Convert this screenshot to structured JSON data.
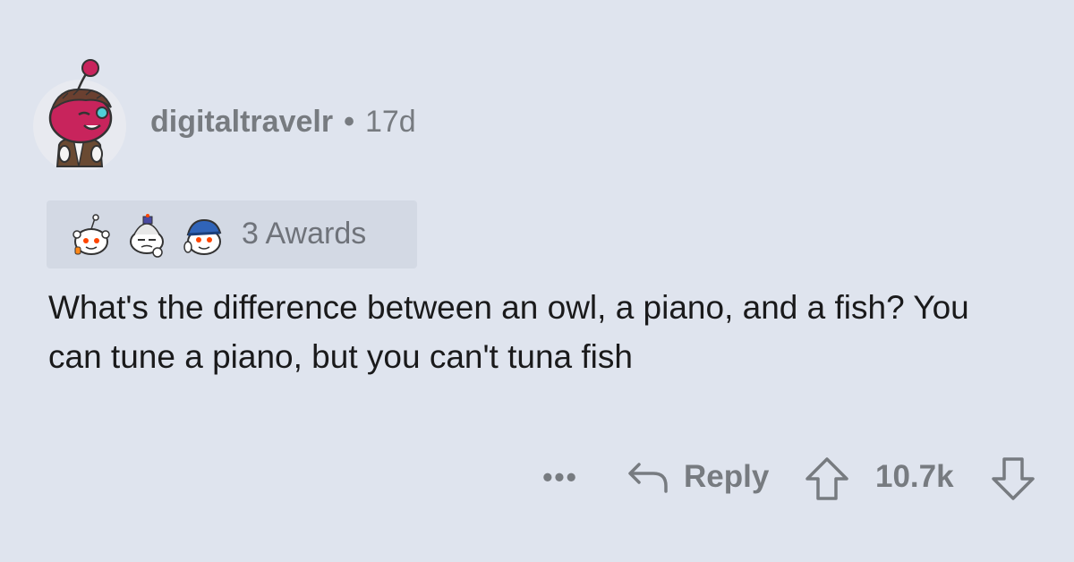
{
  "comment": {
    "author": "digitaltravelr",
    "separator": "•",
    "age": "17d",
    "avatar_icon": "snoo-avatar-icon",
    "awards": {
      "label": "3 Awards",
      "icons": [
        "wholesome-award-icon",
        "take-my-energy-award-icon",
        "helpful-award-icon"
      ]
    },
    "body": "What's the difference between an owl, a piano, and a fish? You can tune a piano, but you can't tuna fish",
    "actions": {
      "more_label": "•••",
      "reply_label": "Reply",
      "score": "10.7k"
    }
  },
  "colors": {
    "background": "#dfe4ee",
    "awards_background": "#d3d9e4",
    "muted_text": "#777b80",
    "body_text": "#1a1a1b",
    "avatar_pink": "#c8245c"
  }
}
